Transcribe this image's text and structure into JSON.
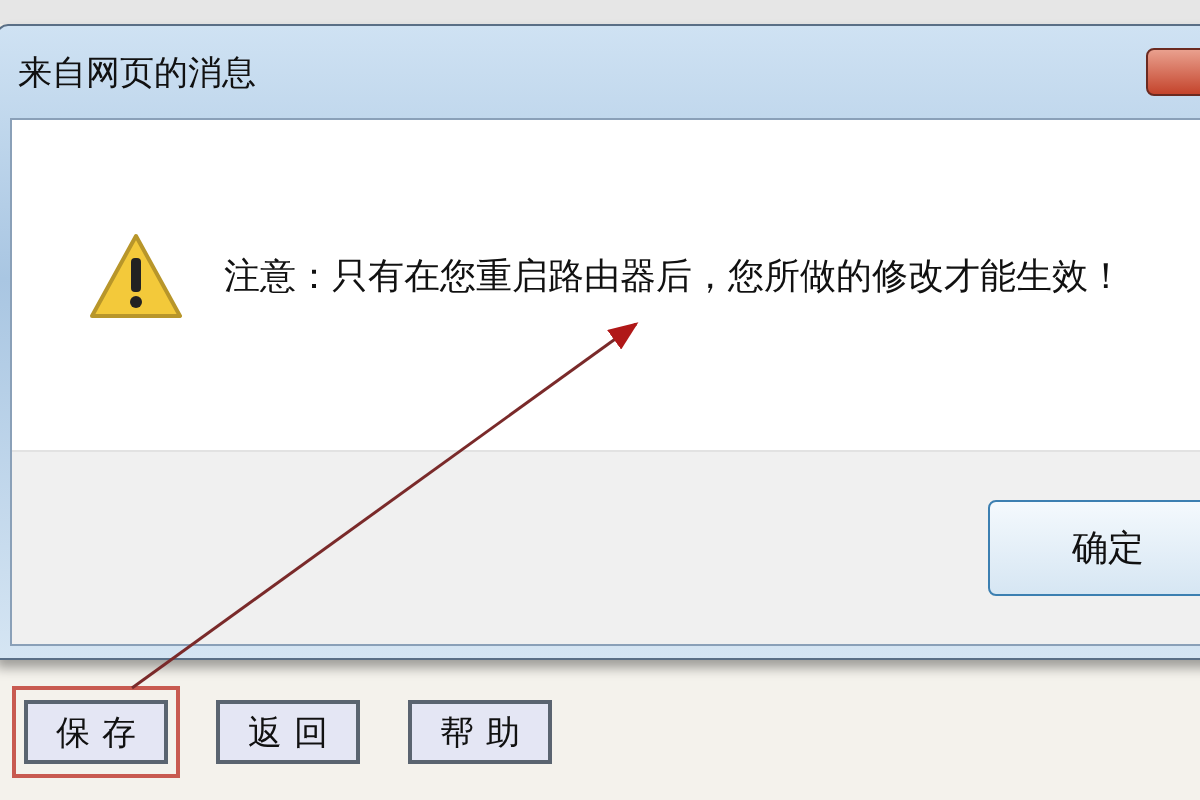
{
  "dialog": {
    "title": "来自网页的消息",
    "message": "注意：只有在您重启路由器后，您所做的修改才能生效！",
    "buttons": [
      "确定"
    ]
  },
  "page_buttons": [
    {
      "label": "保存",
      "highlighted": true
    },
    {
      "label": "返回",
      "highlighted": false
    },
    {
      "label": "帮助",
      "highlighted": false
    }
  ]
}
